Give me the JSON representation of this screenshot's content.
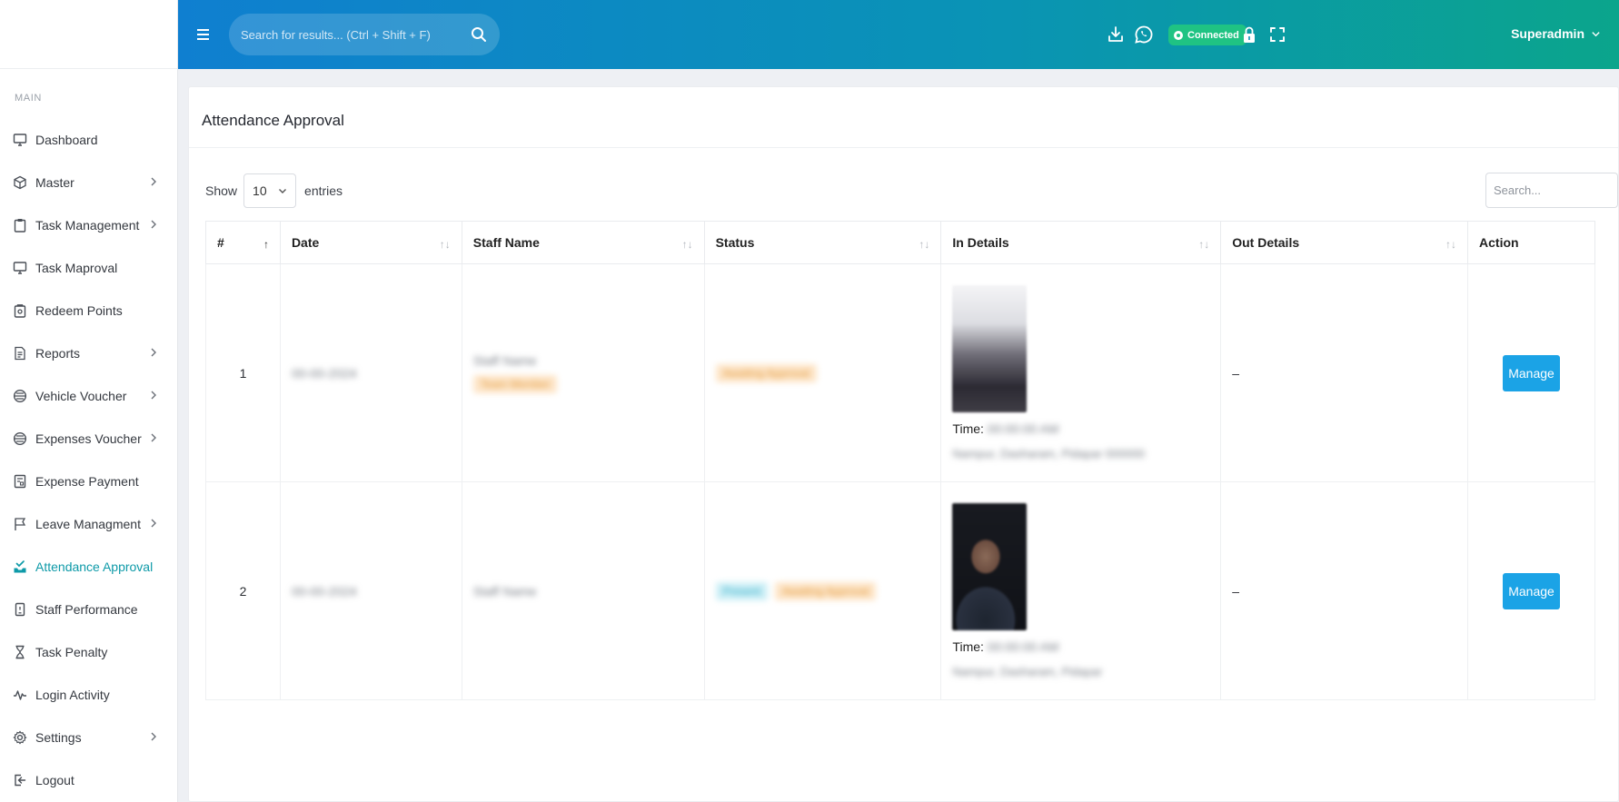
{
  "sidebar": {
    "section_label": "MAIN",
    "items": [
      {
        "label": "Dashboard",
        "icon": "monitor-icon",
        "has_submenu": false,
        "active": false
      },
      {
        "label": "Master",
        "icon": "box-icon",
        "has_submenu": true,
        "active": false
      },
      {
        "label": "Task Management",
        "icon": "clipboard-icon",
        "has_submenu": true,
        "active": false
      },
      {
        "label": "Task Maproval",
        "icon": "monitor-icon",
        "has_submenu": false,
        "active": false
      },
      {
        "label": "Redeem Points",
        "icon": "document-lock-icon",
        "has_submenu": false,
        "active": false
      },
      {
        "label": "Reports",
        "icon": "file-text-icon",
        "has_submenu": true,
        "active": false
      },
      {
        "label": "Vehicle Voucher",
        "icon": "voucher-icon",
        "has_submenu": true,
        "active": false
      },
      {
        "label": "Expenses Voucher",
        "icon": "voucher-icon",
        "has_submenu": true,
        "active": false
      },
      {
        "label": "Expense Payment",
        "icon": "receipt-icon",
        "has_submenu": false,
        "active": false
      },
      {
        "label": "Leave Managment",
        "icon": "flag-icon",
        "has_submenu": true,
        "active": false
      },
      {
        "label": "Attendance Approval",
        "icon": "tray-check-icon",
        "has_submenu": false,
        "active": true
      },
      {
        "label": "Staff Performance",
        "icon": "mobile-icon",
        "has_submenu": false,
        "active": false
      },
      {
        "label": "Task Penalty",
        "icon": "hourglass-icon",
        "has_submenu": false,
        "active": false
      },
      {
        "label": "Login Activity",
        "icon": "activity-icon",
        "has_submenu": false,
        "active": false
      },
      {
        "label": "Settings",
        "icon": "gear-icon",
        "has_submenu": true,
        "active": false
      },
      {
        "label": "Logout",
        "icon": "logout-icon",
        "has_submenu": false,
        "active": false
      }
    ]
  },
  "header": {
    "search_placeholder": "Search for results... (Ctrl + Shift + F)",
    "connected_label": "Connected",
    "user_name": "Superadmin"
  },
  "page": {
    "title": "Attendance Approval"
  },
  "table_controls": {
    "show_label": "Show",
    "entries_value": "10",
    "entries_label": "entries",
    "search_placeholder": "Search..."
  },
  "table": {
    "columns": [
      "#",
      "Date",
      "Staff Name",
      "Status",
      "In Details",
      "Out Details",
      "Action"
    ],
    "rows": [
      {
        "index": "1",
        "date": "00-00-2024",
        "staff_name": "Staff Name",
        "staff_tag": "Team Member",
        "status_badges": [
          {
            "text": "Awaiting Approval",
            "kind": "warn"
          }
        ],
        "in_time_label": "Time:",
        "in_time": "00:00:00 AM",
        "in_location": "Nampur, Dasharam, Pidapar 000000",
        "out_details": "–",
        "action_label": "Manage"
      },
      {
        "index": "2",
        "date": "00-00-2024",
        "staff_name": "Staff Name",
        "staff_tag": "",
        "status_badges": [
          {
            "text": "Present",
            "kind": "info"
          },
          {
            "text": "Awaiting Approval",
            "kind": "warn"
          }
        ],
        "in_time_label": "Time:",
        "in_time": "00:00:00 AM",
        "in_location": "Nampur, Dasharam, Pidapar",
        "out_details": "–",
        "action_label": "Manage"
      }
    ]
  },
  "colors": {
    "header_gradient_start": "#0f7fd0",
    "header_gradient_end": "#0ba58c",
    "active_item": "#0e9aa8",
    "manage_button": "#1ba3e6",
    "connected_badge": "#1fc383"
  }
}
